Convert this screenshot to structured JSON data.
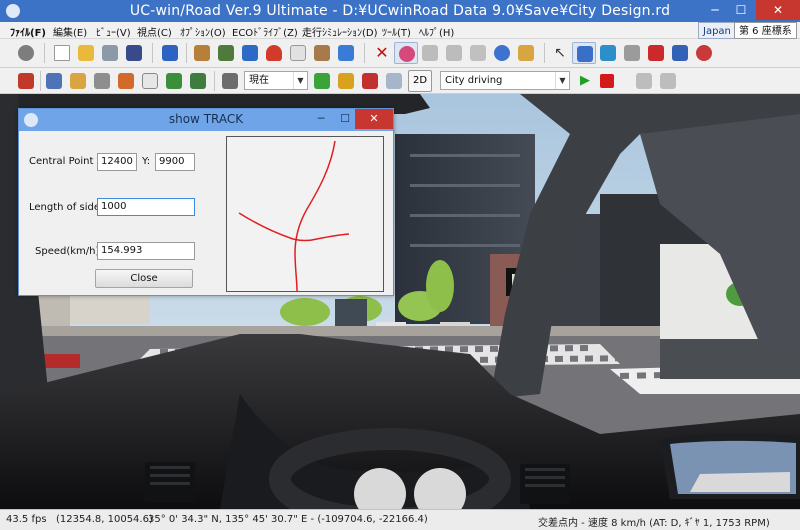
{
  "window": {
    "title": "UC-win/Road Ver.9 Ultimate - D:¥UCwinRoad Data 9.0¥Save¥City Design.rd",
    "minimize": "─",
    "maximize": "☐",
    "close": "✕"
  },
  "menu": {
    "items": [
      {
        "label": "ﾌｧｲﾙ(F)"
      },
      {
        "label": "編集(E)"
      },
      {
        "label": "ﾋﾞｭｰ(V)"
      },
      {
        "label": "視点(C)"
      },
      {
        "label": "ｵﾌﾟｼｮﾝ(O)"
      },
      {
        "label": "ECOﾄﾞﾗｲﾌﾞ(Z)"
      },
      {
        "label": "走行ｼﾐｭﾚｰｼｮﾝ(D)"
      },
      {
        "label": "ﾂｰﾙ(T)"
      },
      {
        "label": "ﾍﾙﾌﾟ(H)"
      }
    ],
    "region": "Japan",
    "coord_system": "第 6 座標系"
  },
  "toolbar2": {
    "view_select": "現在",
    "view_2d": "2D",
    "scenario_select": "City driving",
    "play": "▶"
  },
  "dialog": {
    "title": "show TRACK",
    "minimize": "─",
    "maximize": "☐",
    "close": "✕",
    "central_point_label": "Central Point X:",
    "central_x": "12400",
    "y_label": "Y:",
    "central_y": "9900",
    "length_label": "Length of sides:",
    "length_value": "1000",
    "speed_label": "Speed(km/h):",
    "speed_value": "154.993",
    "close_button": "Close"
  },
  "status": {
    "fps": "43.5 fps",
    "position": "(12354.8, 10054.6)",
    "latlon": "35°  0' 34.3\" N, 135°  45' 30.7\" E  -  (-109704.6, -22166.4)",
    "drive_info": "交差点内 - 速度 8 km/h (AT: D, ｷﾞﾔ 1, 1753 RPM)"
  },
  "colors": {
    "titlebar": "#3d73c6",
    "dialog_titlebar": "#6fa5e8",
    "track_line": "#e02020",
    "sky": "#d8e6f1",
    "road": "#6e6e72"
  }
}
